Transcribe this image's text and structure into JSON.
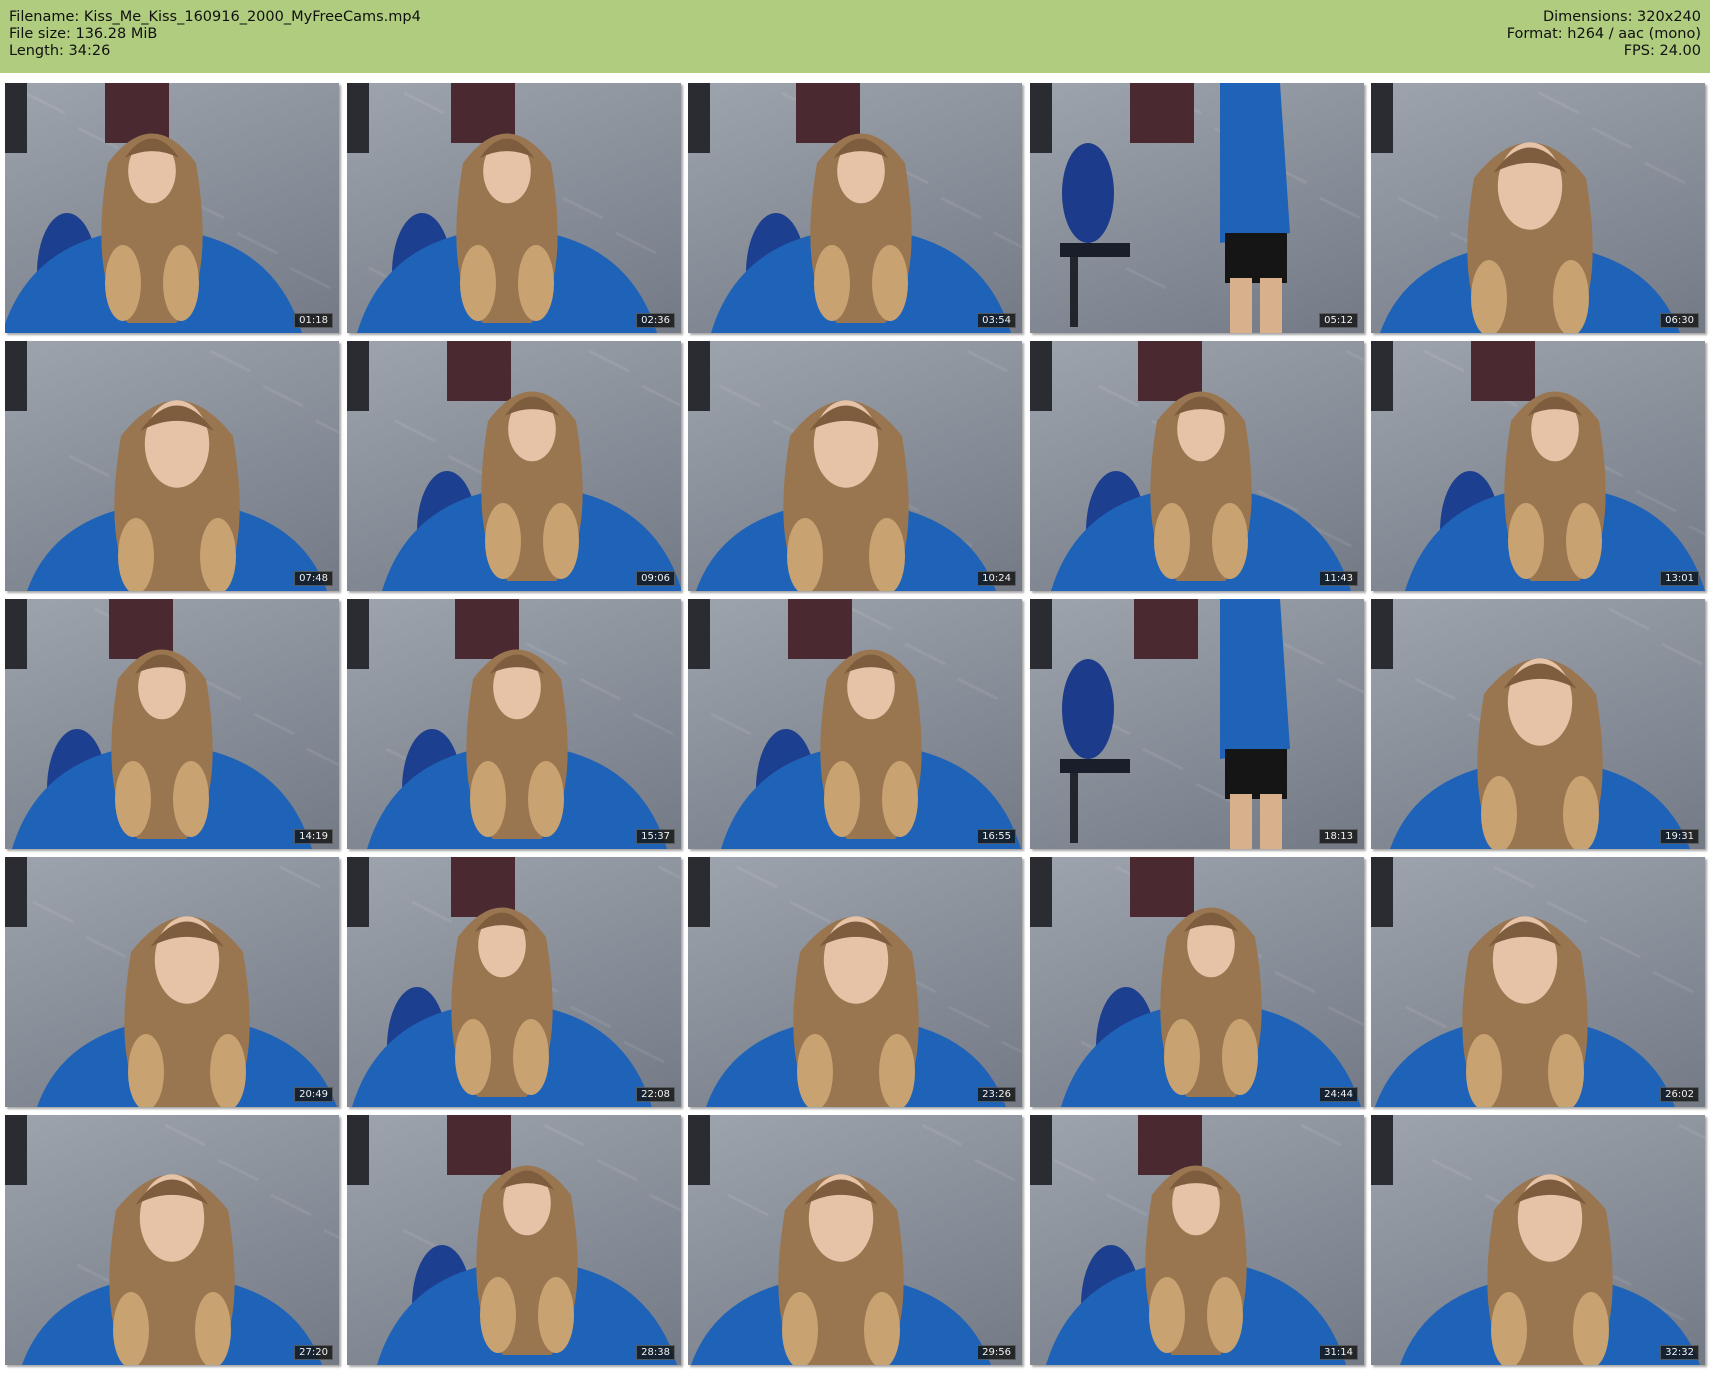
{
  "header": {
    "left": [
      "Filename: Kiss_Me_Kiss_160916_2000_MyFreeCams.mp4",
      "File size: 136.28 MiB",
      "Length: 34:26"
    ],
    "right": [
      "Dimensions: 320x240",
      "Format: h264 / aac (mono)",
      "FPS: 24.00"
    ]
  },
  "colors": {
    "header_bg": "#b0cc7f",
    "wall": "#8b919b",
    "shirt": "#1f63b8",
    "hair": "#9a7650"
  },
  "thumbnails": [
    {
      "time": "01:18",
      "scene": "seated"
    },
    {
      "time": "02:36",
      "scene": "seated"
    },
    {
      "time": "03:54",
      "scene": "seated"
    },
    {
      "time": "05:12",
      "scene": "standing"
    },
    {
      "time": "06:30",
      "scene": "closeup"
    },
    {
      "time": "07:48",
      "scene": "closeup"
    },
    {
      "time": "09:06",
      "scene": "seated"
    },
    {
      "time": "10:24",
      "scene": "closeup"
    },
    {
      "time": "11:43",
      "scene": "seated"
    },
    {
      "time": "13:01",
      "scene": "seated"
    },
    {
      "time": "14:19",
      "scene": "seated"
    },
    {
      "time": "15:37",
      "scene": "seated"
    },
    {
      "time": "16:55",
      "scene": "seated"
    },
    {
      "time": "18:13",
      "scene": "standing"
    },
    {
      "time": "19:31",
      "scene": "closeup"
    },
    {
      "time": "20:49",
      "scene": "closeup"
    },
    {
      "time": "22:08",
      "scene": "seated"
    },
    {
      "time": "23:26",
      "scene": "closeup"
    },
    {
      "time": "24:44",
      "scene": "seated"
    },
    {
      "time": "26:02",
      "scene": "closeup"
    },
    {
      "time": "27:20",
      "scene": "closeup"
    },
    {
      "time": "28:38",
      "scene": "seated"
    },
    {
      "time": "29:56",
      "scene": "closeup"
    },
    {
      "time": "31:14",
      "scene": "seated"
    },
    {
      "time": "32:32",
      "scene": "closeup"
    }
  ]
}
